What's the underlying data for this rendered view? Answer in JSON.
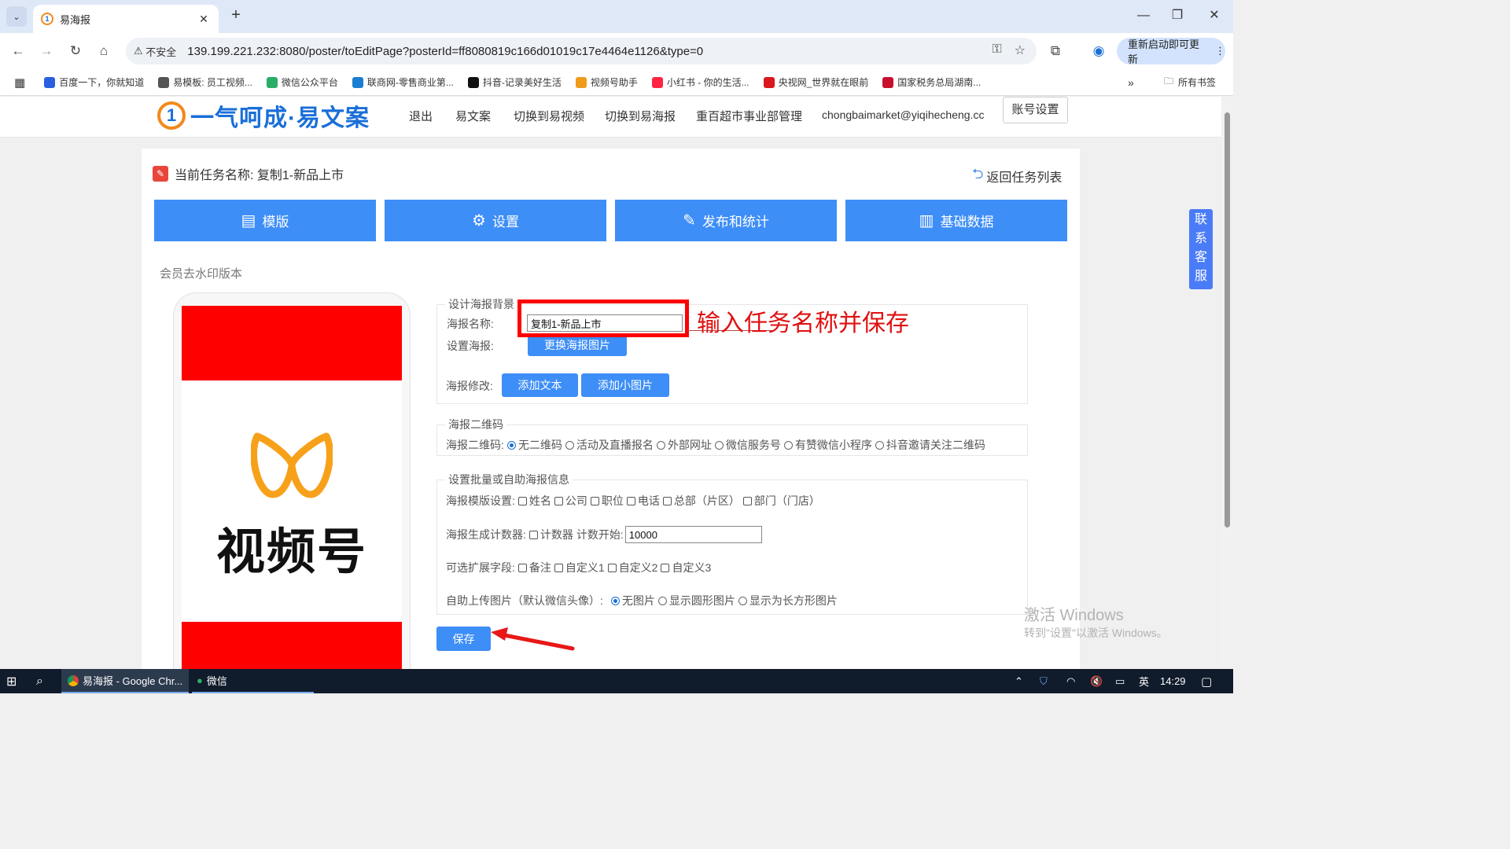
{
  "browser": {
    "tab_title": "易海报",
    "url": "139.199.221.232:8080/poster/toEditPage?posterId=ff8080819c166d01019c17e4464e1126&type=0",
    "insecure_label": "不安全",
    "update_button": "重新启动即可更新",
    "bookmarks": [
      {
        "label": "百度一下，你就知道",
        "icon": "baidu-icon",
        "color": "#2b5fe0"
      },
      {
        "label": "易模板: 员工视频...",
        "icon": "globe-icon",
        "color": "#555555"
      },
      {
        "label": "微信公众平台",
        "icon": "wechat-icon",
        "color": "#2aae67"
      },
      {
        "label": "联商网-零售商业第...",
        "icon": "lianshang-icon",
        "color": "#1a7fd1"
      },
      {
        "label": "抖音-记录美好生活",
        "icon": "douyin-icon",
        "color": "#111111"
      },
      {
        "label": "视频号助手",
        "icon": "channels-icon",
        "color": "#f09b1c"
      },
      {
        "label": "小红书 - 你的生活...",
        "icon": "xiaohongshu-icon",
        "color": "#ff2442"
      },
      {
        "label": "央视网_世界就在眼前",
        "icon": "cctv-icon",
        "color": "#d9181f"
      },
      {
        "label": "国家税务总局湖南...",
        "icon": "tax-icon",
        "color": "#c8102e"
      }
    ],
    "all_bookmarks": "所有书签"
  },
  "header": {
    "logo_mark": "1",
    "logo_text": "一气呵成·易文案",
    "nav": [
      "退出",
      "易文案",
      "切换到易视频",
      "切换到易海报",
      "重百超市事业部管理",
      "chongbaimarket@yiqihecheng.cc"
    ],
    "account_button": "账号设置"
  },
  "page": {
    "task_label": "当前任务名称: 复制1-新品上市",
    "back_link": "返回任务列表",
    "main_buttons": [
      {
        "label": "模版",
        "icon": "layout-icon"
      },
      {
        "label": "设置",
        "icon": "gear-icon"
      },
      {
        "label": "发布和统计",
        "icon": "edit-icon"
      },
      {
        "label": "基础数据",
        "icon": "data-icon"
      }
    ],
    "watermark_note": "会员去水印版本",
    "poster_preview_text": "视频号"
  },
  "form": {
    "bg_section": {
      "legend": "设计海报背景",
      "name_label": "海报名称:",
      "name_value": "复制1-新品上市",
      "set_label": "设置海报:",
      "change_image_button": "更换海报图片",
      "modify_label": "海报修改:",
      "add_text_button": "添加文本",
      "add_small_image_button": "添加小图片"
    },
    "qr_section": {
      "legend": "海报二维码",
      "label": "海报二维码:",
      "options": [
        "无二维码",
        "活动及直播报名",
        "外部网址",
        "微信服务号",
        "有赞微信小程序",
        "抖音邀请关注二维码"
      ],
      "selected": "无二维码"
    },
    "batch_section": {
      "legend": "设置批量或自助海报信息",
      "template_label": "海报模版设置:",
      "template_fields": [
        "姓名",
        "公司",
        "职位",
        "电话",
        "总部（片区）",
        "部门（门店）"
      ],
      "counter_label": "海报生成计数器:",
      "counter_checkbox": "计数器",
      "counter_start_label": "计数开始:",
      "counter_start_value": "10000",
      "ext_label": "可选扩展字段:",
      "ext_fields": [
        "备注",
        "自定义1",
        "自定义2",
        "自定义3"
      ],
      "upload_label": "自助上传图片（默认微信头像）:",
      "upload_options": [
        "无图片",
        "显示圆形图片",
        "显示为长方形图片"
      ],
      "upload_selected": "无图片"
    },
    "save_button": "保存"
  },
  "annotation": {
    "text": "输入任务名称并保存",
    "color": "#e01010"
  },
  "side_chat": "联系客服",
  "windows_watermark": {
    "line1": "激活 Windows",
    "line2": "转到\"设置\"以激活 Windows。"
  },
  "taskbar": {
    "items": [
      "易海报 - Google Chr...",
      "微信"
    ],
    "ime": "英",
    "time": "14:29"
  }
}
